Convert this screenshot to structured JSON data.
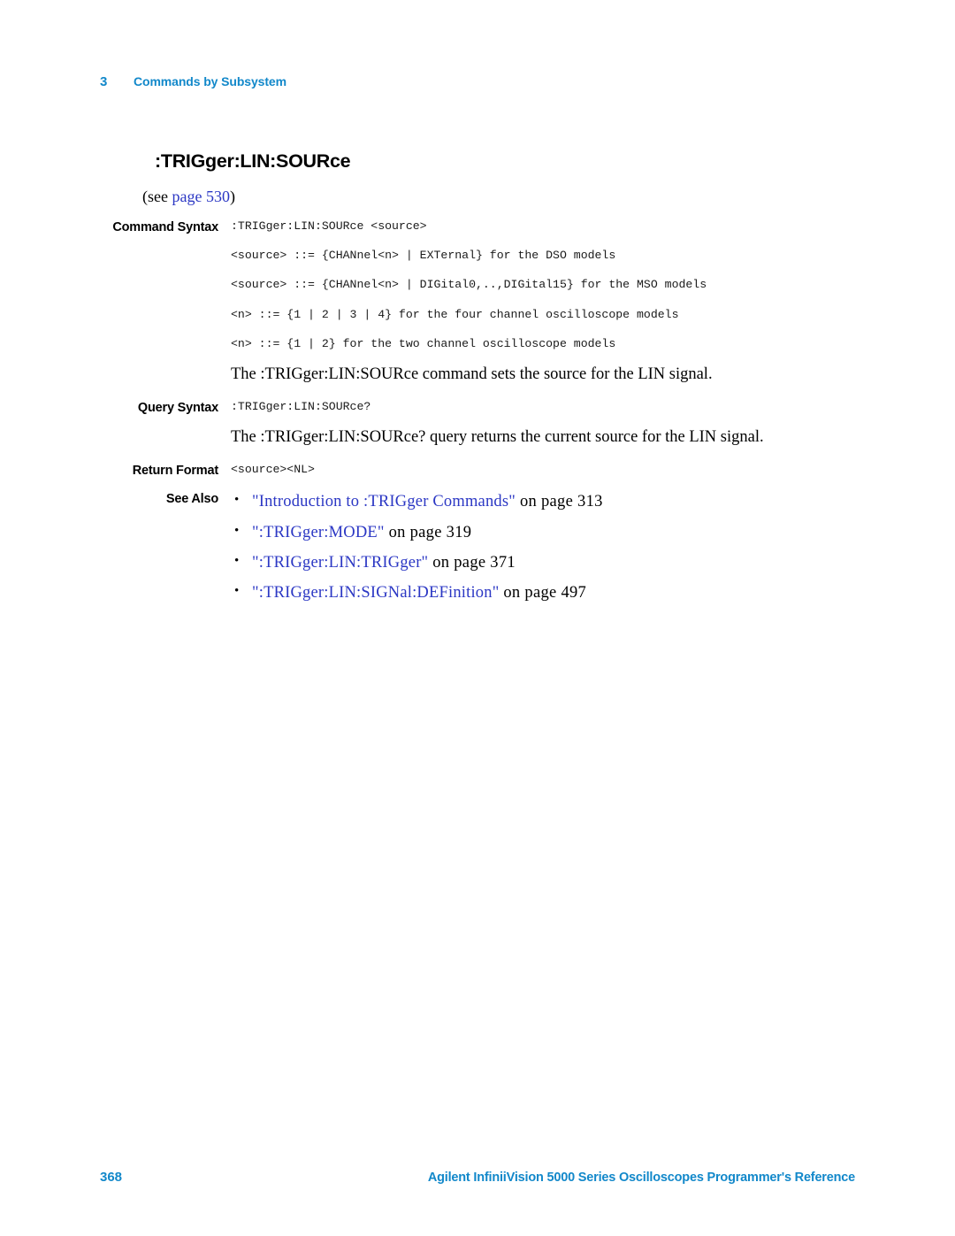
{
  "header": {
    "chapter_number": "3",
    "chapter_title": "Commands by Subsystem"
  },
  "command": {
    "title": ":TRIGger:LIN:SOURce",
    "see_prefix": "(see ",
    "see_link": "page 530",
    "see_suffix": ")"
  },
  "labels": {
    "command_syntax": "Command Syntax",
    "query_syntax": "Query Syntax",
    "return_format": "Return Format",
    "see_also": "See Also"
  },
  "command_syntax": {
    "lines": [
      ":TRIGger:LIN:SOURce <source>",
      "<source> ::= {CHANnel<n> | EXTernal} for the DSO models",
      "<source> ::= {CHANnel<n> | DIGital0,..,DIGital15} for the MSO models",
      "<n> ::= {1 | 2 | 3 | 4} for the four channel oscilloscope models",
      "<n> ::= {1 | 2} for the two channel oscilloscope models"
    ]
  },
  "command_description": "The :TRIGger:LIN:SOURce command sets the source for the LIN signal.",
  "query_syntax": {
    "line": ":TRIGger:LIN:SOURce?"
  },
  "query_description": "The :TRIGger:LIN:SOURce? query returns the current source for the LIN signal.",
  "return_format": {
    "line": "<source><NL>"
  },
  "see_also": {
    "items": [
      {
        "bullet": "•",
        "link": "\"Introduction to :TRIGger Commands\"",
        "tail": " on page 313"
      },
      {
        "bullet": "•",
        "link": "\":TRIGger:MODE\"",
        "tail": " on page 319"
      },
      {
        "bullet": "•",
        "link": "\":TRIGger:LIN:TRIGger\"",
        "tail": " on page 371"
      },
      {
        "bullet": "•",
        "link": "\":TRIGger:LIN:SIGNal:DEFinition\"",
        "tail": " on page 497"
      }
    ]
  },
  "footer": {
    "page_number": "368",
    "document_title": "Agilent InfiniiVision 5000 Series Oscilloscopes Programmer's Reference"
  },
  "colors": {
    "agilent_blue": "#1288ca",
    "link_blue": "#2b37c4",
    "text_black": "#000000"
  }
}
